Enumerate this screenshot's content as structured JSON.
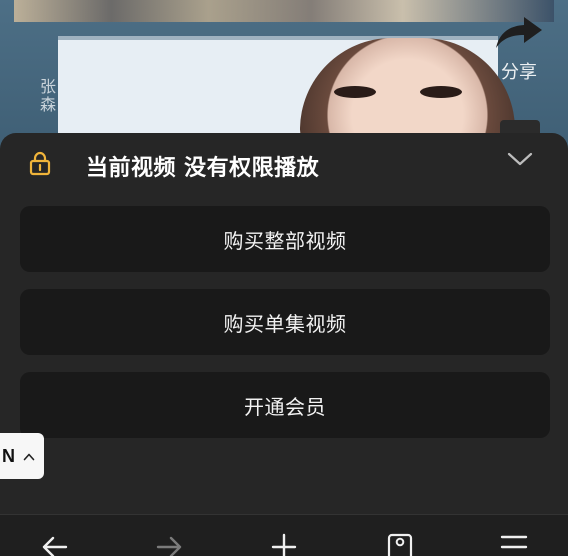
{
  "video": {
    "poster_side_text": "张森",
    "share_label": "分享"
  },
  "permission_sheet": {
    "title": "当前视频 没有权限播放",
    "actions": [
      {
        "label": "购买整部视频"
      },
      {
        "label": "购买单集视频"
      },
      {
        "label": "开通会员"
      }
    ]
  },
  "floating_tag": {
    "letter": "N"
  },
  "colors": {
    "accent_lock": "#f0b43a",
    "sheet_bg": "#262626",
    "button_bg": "#191919"
  },
  "icons": {
    "share": "share-icon",
    "lock": "lock-icon",
    "collapse": "chevron-down-icon",
    "floating_chevron": "chevron-up-icon",
    "nav": [
      "back-arrow-icon",
      "forward-arrow-icon",
      "plus-icon",
      "tabs-icon",
      "menu-icon"
    ]
  }
}
